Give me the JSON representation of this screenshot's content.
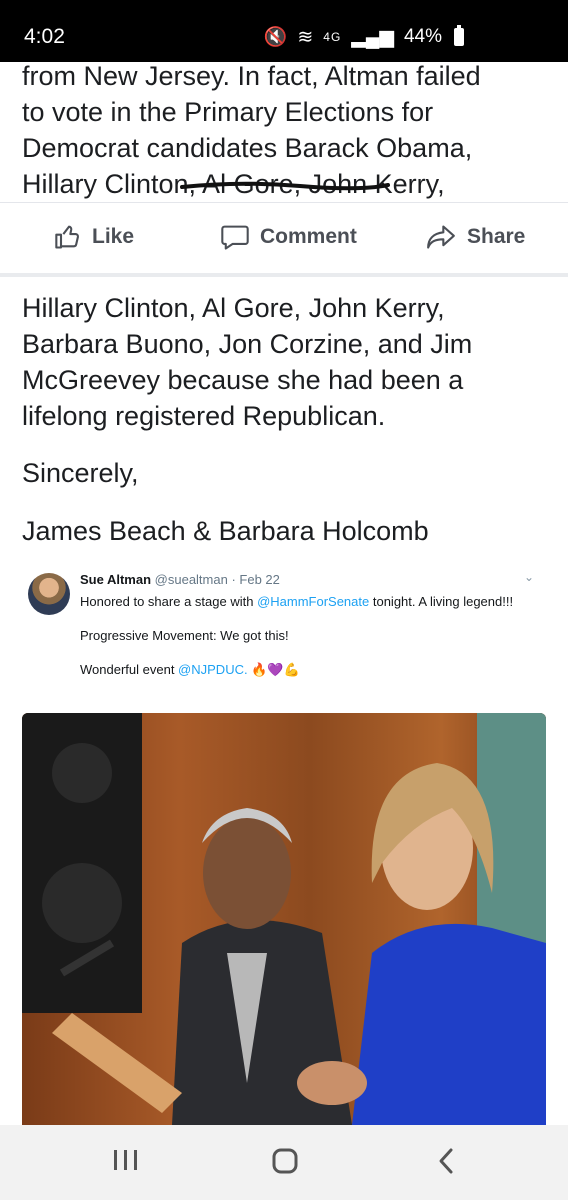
{
  "status": {
    "time": "4:02",
    "network": "4G",
    "battery": "44%"
  },
  "post": {
    "top_lines": [
      "from New Jersey. In fact, Altman failed",
      "to vote in the Primary Elections for",
      "Democrat candidates Barack Obama,",
      "Hillary Clinton, Al Gore, John Kerry,"
    ],
    "mid_lines": [
      "Hillary Clinton, Al Gore, John Kerry,",
      "Barbara Buono, Jon Corzine, and Jim",
      "McGreevey because she had been a",
      "lifelong registered Republican."
    ],
    "closing": "Sincerely,",
    "signature": "James Beach & Barbara Holcomb"
  },
  "actions": {
    "like": "Like",
    "comment": "Comment",
    "share": "Share"
  },
  "tweet": {
    "name": "Sue Altman",
    "handle": "@suealtman",
    "date": "· Feb 22",
    "line1_before": "Honored to share a stage with ",
    "line1_link": "@HammForSenate",
    "line1_after": " tonight. A living legend!!!",
    "line2": "Progressive Movement: We got this!",
    "line3_before": "Wonderful event ",
    "line3_link": "@NJPDUC.",
    "line3_emoji": "🔥💜💪"
  },
  "colors": {
    "link": "#1da1f2",
    "text": "#1c1e21",
    "action": "#4b4f56",
    "nav_bg": "#f2f2f2"
  },
  "icons": [
    "thumbs-up-icon",
    "comment-icon",
    "share-icon",
    "recent-apps-icon",
    "home-icon",
    "back-icon"
  ]
}
